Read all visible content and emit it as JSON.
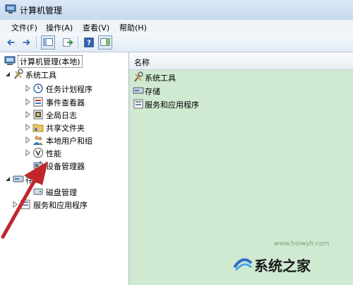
{
  "window": {
    "title": "计算机管理",
    "icon": "computer-management-icon"
  },
  "menu": [
    "文件(F)",
    "操作(A)",
    "查看(V)",
    "帮助(H)"
  ],
  "tree": {
    "root": "计算机管理(本地)",
    "system_tools": "系统工具",
    "system_tools_children": [
      "任务计划程序",
      "事件查看器",
      "全局日志",
      "共享文件夹",
      "本地用户和组",
      "性能",
      "设备管理器"
    ],
    "storage": "存储",
    "storage_children": [
      "磁盘管理"
    ],
    "services": "服务和应用程序"
  },
  "list": {
    "column_header": "名称",
    "items": [
      "系统工具",
      "存储",
      "服务和应用程序"
    ]
  },
  "watermark": {
    "text": "系统之家",
    "url": "www.hoiwyh.com"
  },
  "colors": {
    "list_background": "#d0ead2",
    "arrow": "#c0262c"
  }
}
